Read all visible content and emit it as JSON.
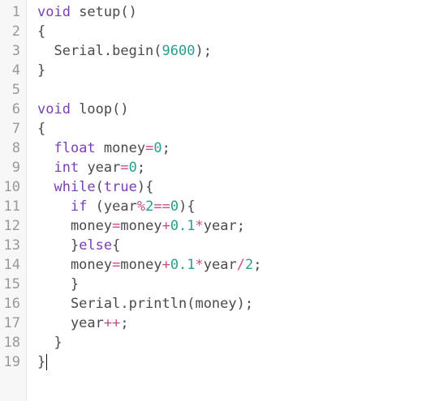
{
  "editor": {
    "line_numbers": [
      "1",
      "2",
      "3",
      "4",
      "5",
      "6",
      "7",
      "8",
      "9",
      "10",
      "11",
      "12",
      "13",
      "14",
      "15",
      "16",
      "17",
      "18",
      "19"
    ],
    "lines": [
      [
        {
          "t": "void",
          "c": "kw"
        },
        {
          "t": " setup()",
          "c": "plain"
        }
      ],
      [
        {
          "t": "{",
          "c": "plain"
        }
      ],
      [
        {
          "t": "  Serial.begin(",
          "c": "plain"
        },
        {
          "t": "9600",
          "c": "num"
        },
        {
          "t": ");",
          "c": "plain"
        }
      ],
      [
        {
          "t": "}",
          "c": "plain"
        }
      ],
      [],
      [
        {
          "t": "void",
          "c": "kw"
        },
        {
          "t": " loop()",
          "c": "plain"
        }
      ],
      [
        {
          "t": "{",
          "c": "plain"
        }
      ],
      [
        {
          "t": "  ",
          "c": "plain"
        },
        {
          "t": "float",
          "c": "type"
        },
        {
          "t": " money",
          "c": "plain"
        },
        {
          "t": "=",
          "c": "op"
        },
        {
          "t": "0",
          "c": "num"
        },
        {
          "t": ";",
          "c": "plain"
        }
      ],
      [
        {
          "t": "  ",
          "c": "plain"
        },
        {
          "t": "int",
          "c": "type"
        },
        {
          "t": " year",
          "c": "plain"
        },
        {
          "t": "=",
          "c": "op"
        },
        {
          "t": "0",
          "c": "num"
        },
        {
          "t": ";",
          "c": "plain"
        }
      ],
      [
        {
          "t": "  ",
          "c": "plain"
        },
        {
          "t": "while",
          "c": "kw"
        },
        {
          "t": "(",
          "c": "plain"
        },
        {
          "t": "true",
          "c": "kw"
        },
        {
          "t": "){",
          "c": "plain"
        }
      ],
      [
        {
          "t": "    ",
          "c": "plain"
        },
        {
          "t": "if",
          "c": "kw"
        },
        {
          "t": " (year",
          "c": "plain"
        },
        {
          "t": "%",
          "c": "op"
        },
        {
          "t": "2",
          "c": "num"
        },
        {
          "t": "==",
          "c": "op"
        },
        {
          "t": "0",
          "c": "num"
        },
        {
          "t": "){",
          "c": "plain"
        }
      ],
      [
        {
          "t": "    money",
          "c": "plain"
        },
        {
          "t": "=",
          "c": "op"
        },
        {
          "t": "money",
          "c": "plain"
        },
        {
          "t": "+",
          "c": "op"
        },
        {
          "t": "0.1",
          "c": "num"
        },
        {
          "t": "*",
          "c": "op"
        },
        {
          "t": "year;",
          "c": "plain"
        }
      ],
      [
        {
          "t": "    }",
          "c": "plain"
        },
        {
          "t": "else",
          "c": "kw"
        },
        {
          "t": "{",
          "c": "plain"
        }
      ],
      [
        {
          "t": "    money",
          "c": "plain"
        },
        {
          "t": "=",
          "c": "op"
        },
        {
          "t": "money",
          "c": "plain"
        },
        {
          "t": "+",
          "c": "op"
        },
        {
          "t": "0.1",
          "c": "num"
        },
        {
          "t": "*",
          "c": "op"
        },
        {
          "t": "year",
          "c": "plain"
        },
        {
          "t": "/",
          "c": "op"
        },
        {
          "t": "2",
          "c": "num"
        },
        {
          "t": ";",
          "c": "plain"
        }
      ],
      [
        {
          "t": "    }",
          "c": "plain"
        }
      ],
      [
        {
          "t": "    Serial.println(money);",
          "c": "plain"
        }
      ],
      [
        {
          "t": "    year",
          "c": "plain"
        },
        {
          "t": "++",
          "c": "op"
        },
        {
          "t": ";",
          "c": "plain"
        }
      ],
      [
        {
          "t": "  }",
          "c": "plain"
        }
      ],
      [
        {
          "t": "}",
          "c": "plain"
        }
      ]
    ]
  }
}
